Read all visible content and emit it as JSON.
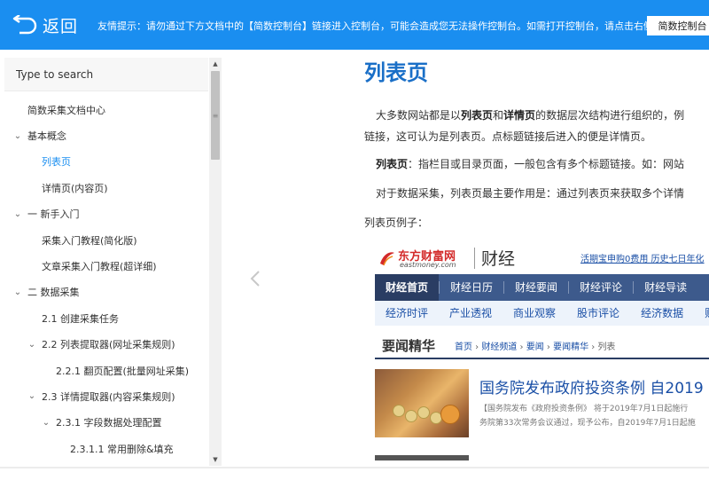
{
  "topbar": {
    "back_label": "返回",
    "notice": "友情提示：请勿通过下方文档中的【简数控制台】链接进入控制台，可能会造成您无法操作控制台。如需打开控制台，请点击右侧按钮。",
    "console_button": "简数控制台",
    "bg_color": "#1a8ef0"
  },
  "sidebar": {
    "search_placeholder": "Type to search",
    "toc": [
      {
        "label": "简数采集文档中心",
        "chevron": ""
      },
      {
        "label": "基本概念",
        "chevron": "chevron-down"
      },
      {
        "label": "列表页",
        "chevron": "",
        "active": true
      },
      {
        "label": "详情页(内容页)",
        "chevron": ""
      },
      {
        "label": "一 新手入门",
        "chevron": "chevron-down"
      },
      {
        "label": "采集入门教程(简化版)",
        "chevron": ""
      },
      {
        "label": "文章采集入门教程(超详细)",
        "chevron": ""
      },
      {
        "label": "二 数据采集",
        "chevron": "chevron-down"
      },
      {
        "label": "2.1 创建采集任务",
        "chevron": ""
      },
      {
        "label": "2.2 列表提取器(网址采集规则)",
        "chevron": "chevron-down"
      },
      {
        "label": "2.2.1 翻页配置(批量网址采集)",
        "chevron": ""
      },
      {
        "label": "2.3 详情提取器(内容采集规则)",
        "chevron": "chevron-down"
      },
      {
        "label": "2.3.1 字段数据处理配置",
        "chevron": "chevron-down"
      },
      {
        "label": "2.3.1.1 常用删除&填充",
        "chevron": ""
      }
    ]
  },
  "content": {
    "title": "列表页",
    "p1_pre": "大多数网站都是以",
    "p1_b1": "列表页",
    "p1_mid": "和",
    "p1_b2": "详情页",
    "p1_post": "的数据层次结构进行组织的，例",
    "p1_line2": "链接，这可认为是列表页。点标题链接后进入的便是详情页。",
    "p2_b": "列表页",
    "p2_post": "：指栏目或目录页面，一般包含有多个标题链接。如：网站",
    "p3": "对于数据采集，列表页最主要作用是：通过列表页来获取多个详情",
    "p4": "列表页例子："
  },
  "example": {
    "brand": "东方财富网",
    "domain": "eastmoney.com",
    "section": "财经",
    "promo": "活期宝申购0费用  历史七日年化",
    "nav1": [
      "财经首页",
      "财经日历",
      "财经要闻",
      "财经评论",
      "财经导读"
    ],
    "nav2": [
      "经济时评",
      "产业透视",
      "商业观察",
      "股市评论",
      "经济数据",
      "财"
    ],
    "section_title": "要闻精华",
    "breadcrumbs": [
      "首页",
      "财经频道",
      "要闻",
      "要闻精华",
      "列表"
    ],
    "news_title": "国务院发布政府投资条例 自2019",
    "news_summary_1": "【国务院发布《政府投资条例》 将于2019年7月1日起施行",
    "news_summary_2": "务院第33次常务会议通过，现予公布，自2019年7月1日起施"
  }
}
